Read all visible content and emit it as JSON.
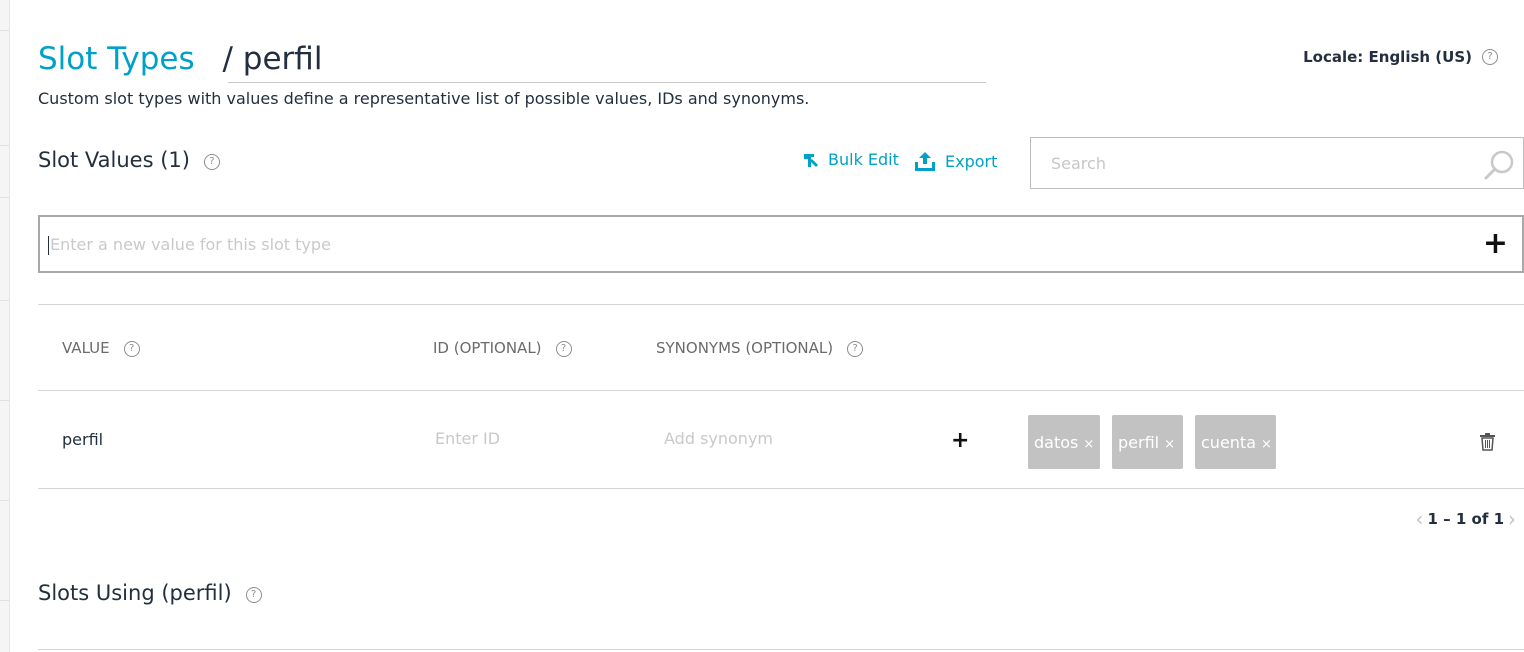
{
  "header": {
    "breadcrumb_link": "Slot Types",
    "separator": "/",
    "slot_type_name": "perfil",
    "locale": "Locale: English (US)",
    "description": "Custom slot types with values define a representative list of possible values, IDs and synonyms."
  },
  "slot_values": {
    "title": "Slot Values (1)",
    "bulk_edit_label": "Bulk Edit",
    "export_label": "Export",
    "search_placeholder": "Search",
    "new_value_placeholder": "Enter a new value for this slot type",
    "add_glyph": "+",
    "columns": {
      "value": "VALUE",
      "id": "ID (OPTIONAL)",
      "synonyms": "SYNONYMS (OPTIONAL)"
    },
    "rows": [
      {
        "value": "perfil",
        "id_placeholder": "Enter ID",
        "synonym_placeholder": "Add synonym",
        "synonyms": [
          "datos",
          "perfil",
          "cuenta"
        ]
      }
    ],
    "remove_glyph": "×",
    "pagination": {
      "prev": "‹",
      "text": "1 – 1 of 1",
      "next": "›"
    }
  },
  "slots_using": {
    "title": "Slots Using (perfil)"
  },
  "help_glyph": "?",
  "colors": {
    "accent": "#00a1c9",
    "chip_bg": "#c2c2c2",
    "text": "#232f3e"
  }
}
